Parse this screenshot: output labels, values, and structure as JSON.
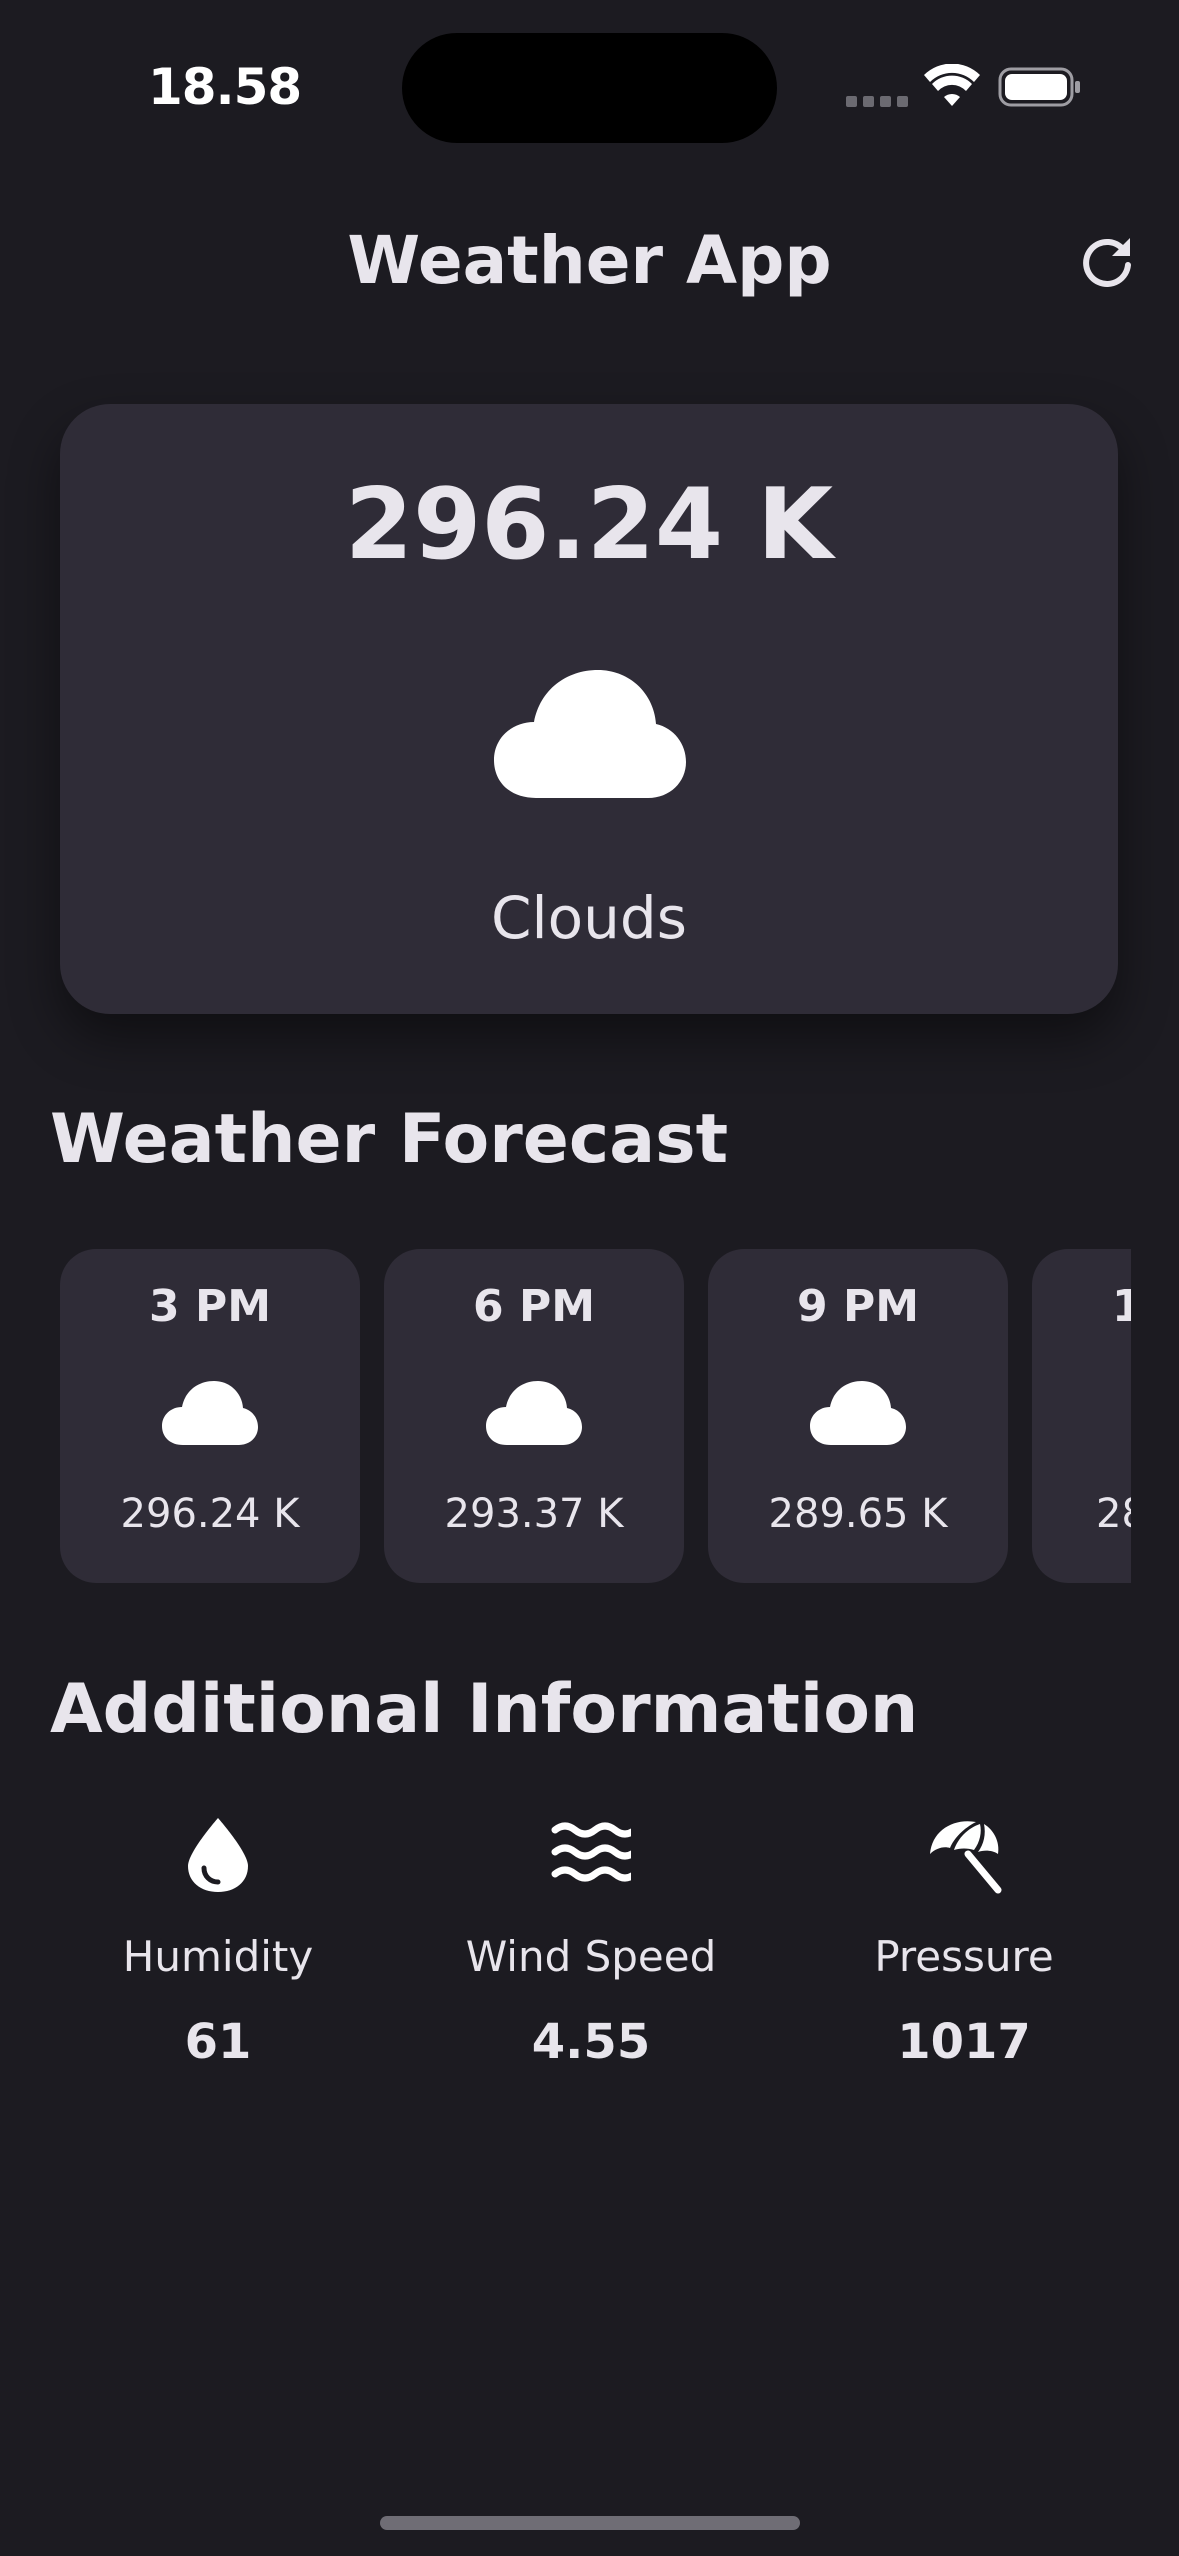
{
  "status_bar": {
    "time": "18.58"
  },
  "header": {
    "title": "Weather App",
    "refresh_icon": "refresh-icon"
  },
  "current": {
    "temperature": "296.24 K",
    "condition": "Clouds",
    "icon": "cloud-icon"
  },
  "forecast": {
    "title": "Weather Forecast",
    "items": [
      {
        "time": "3 PM",
        "temperature": "296.24 K",
        "icon": "cloud-icon"
      },
      {
        "time": "6 PM",
        "temperature": "293.37 K",
        "icon": "cloud-icon"
      },
      {
        "time": "9 PM",
        "temperature": "289.65 K",
        "icon": "cloud-icon"
      },
      {
        "time": "1",
        "temperature": "28",
        "icon": "cloud-icon"
      }
    ]
  },
  "additional": {
    "title": "Additional Information",
    "items": [
      {
        "label": "Humidity",
        "value": "61",
        "icon": "water-drop-icon"
      },
      {
        "label": "Wind Speed",
        "value": "4.55",
        "icon": "wind-waves-icon"
      },
      {
        "label": "Pressure",
        "value": "1017",
        "icon": "umbrella-icon"
      }
    ]
  },
  "colors": {
    "background": "#1c1b21",
    "card": "#2f2c37",
    "text": "#e8e5ec"
  }
}
